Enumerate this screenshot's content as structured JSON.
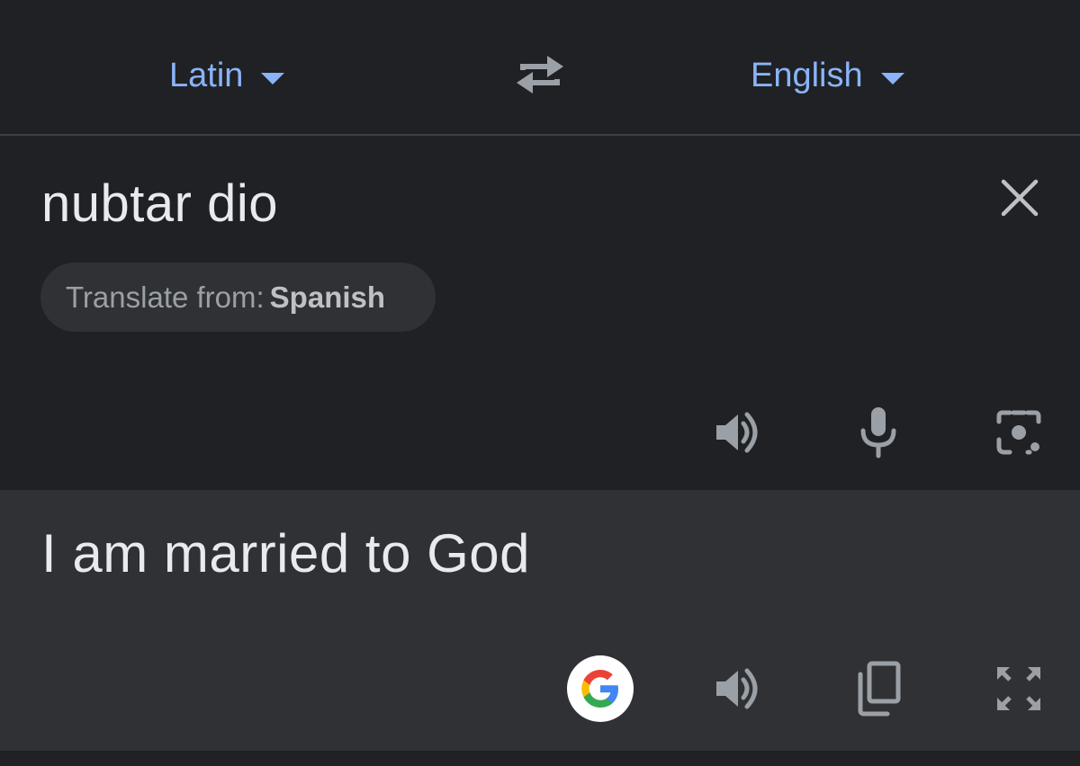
{
  "language_bar": {
    "source_language": "Latin",
    "target_language": "English",
    "swap_icon": "swap-arrows-icon",
    "dropdown_icon": "caret-down-icon"
  },
  "source": {
    "input_text": "nubtar dio",
    "detect_chip": {
      "prefix": "Translate from:",
      "language": "Spanish"
    },
    "icons": {
      "clear": "close-icon",
      "speaker": "speaker-icon",
      "microphone": "microphone-icon",
      "camera": "camera-lens-icon"
    }
  },
  "result": {
    "translated_text": "I am married to God",
    "icons": {
      "google": "google-logo-icon",
      "speaker": "speaker-icon",
      "copy": "copy-icon",
      "fullscreen": "fullscreen-icon"
    }
  },
  "colors": {
    "background": "#202124",
    "result_background": "#303134",
    "accent": "#8ab4f8",
    "icon_gray": "#9aa0a6",
    "text": "#e8eaed"
  }
}
